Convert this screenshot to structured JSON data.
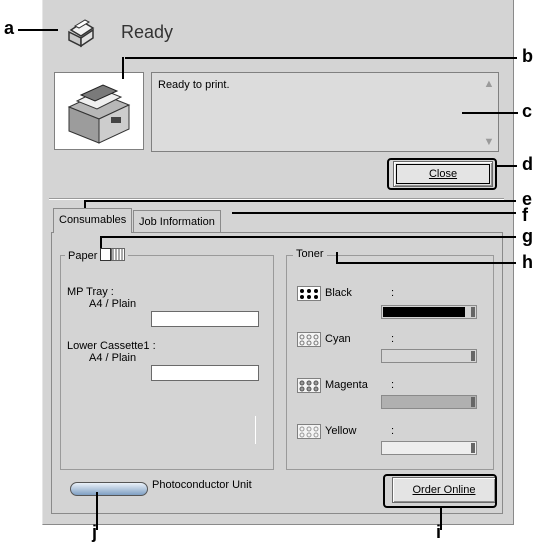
{
  "status": {
    "title": "Ready",
    "message": "Ready to print."
  },
  "buttons": {
    "close": "Close",
    "order_online": "Order Online"
  },
  "tabs": [
    {
      "label": "Consumables"
    },
    {
      "label": "Job Information"
    }
  ],
  "paper": {
    "label": "Paper",
    "sources": [
      {
        "name": "MP Tray :",
        "media": "A4 / Plain"
      },
      {
        "name": "Lower Cassette1 :",
        "media": "A4 / Plain"
      }
    ]
  },
  "toner": {
    "label": "Toner",
    "items": [
      {
        "name": "Black",
        "sep": ":",
        "color": "#000000"
      },
      {
        "name": "Cyan",
        "sep": ":",
        "color": "#d6d6d6"
      },
      {
        "name": "Magenta",
        "sep": ":",
        "color": "#b0b0b0"
      },
      {
        "name": "Yellow",
        "sep": ":",
        "color": "#eeeeee"
      }
    ]
  },
  "photoconductor": {
    "label": "Photoconductor Unit"
  },
  "callouts": [
    "a",
    "b",
    "c",
    "d",
    "e",
    "f",
    "g",
    "h",
    "i",
    "j"
  ]
}
